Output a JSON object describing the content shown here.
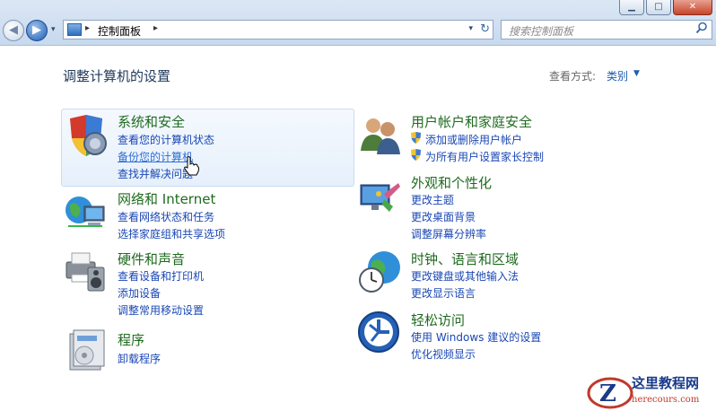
{
  "window": {
    "minimize_glyph": "▁",
    "maximize_glyph": "□",
    "close_glyph": "✕"
  },
  "nav": {
    "back_glyph": "◀",
    "forward_glyph": "▶",
    "history_glyph": "▾"
  },
  "address": {
    "separator": "▸",
    "crumb": "控制面板",
    "dropdown_glyph": "▾",
    "refresh_glyph": "↻"
  },
  "search": {
    "placeholder": "搜索控制面板",
    "icon": "magnifier-icon"
  },
  "content": {
    "title": "调整计算机的设置",
    "view_label": "查看方式:",
    "view_value": "类别",
    "view_arrow": "▼"
  },
  "categories_left": [
    {
      "title": "系统和安全",
      "icon": "shield-icon",
      "links": [
        "查看您的计算机状态",
        "备份您的计算机",
        "查找并解决问题"
      ]
    },
    {
      "title": "网络和 Internet",
      "icon": "network-globe-icon",
      "links": [
        "查看网络状态和任务",
        "选择家庭组和共享选项"
      ]
    },
    {
      "title": "硬件和声音",
      "icon": "printer-speaker-icon",
      "links": [
        "查看设备和打印机",
        "添加设备",
        "调整常用移动设置"
      ]
    },
    {
      "title": "程序",
      "icon": "programs-icon",
      "links": [
        "卸载程序"
      ]
    }
  ],
  "categories_right": [
    {
      "title": "用户帐户和家庭安全",
      "icon": "users-icon",
      "links": [
        "添加或删除用户帐户",
        "为所有用户设置家长控制"
      ]
    },
    {
      "title": "外观和个性化",
      "icon": "appearance-icon",
      "links": [
        "更改主题",
        "更改桌面背景",
        "调整屏幕分辨率"
      ]
    },
    {
      "title": "时钟、语言和区域",
      "icon": "clock-globe-icon",
      "links": [
        "更改键盘或其他输入法",
        "更改显示语言"
      ]
    },
    {
      "title": "轻松访问",
      "icon": "ease-of-access-icon",
      "links": [
        "使用 Windows 建议的设置",
        "优化视频显示"
      ]
    }
  ],
  "watermark": {
    "name": "这里教程网",
    "url": "herecours.com"
  },
  "colors": {
    "category_title": "#1f6b1f",
    "link": "#1a47b5",
    "header_text": "#1e395b"
  }
}
